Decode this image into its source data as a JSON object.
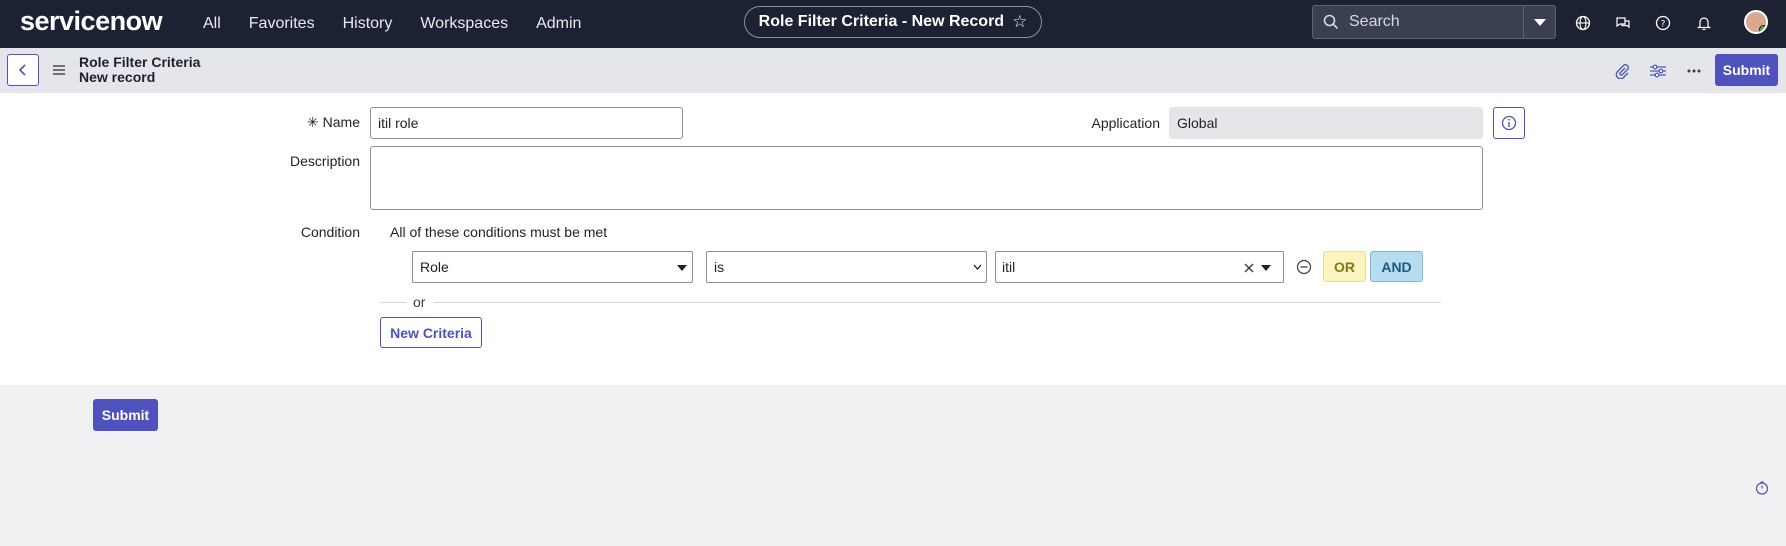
{
  "nav": {
    "logo": "servicenow",
    "items": [
      "All",
      "Favorites",
      "History",
      "Workspaces",
      "Admin"
    ],
    "record_title": "Role Filter Criteria - New Record",
    "search_placeholder": "Search"
  },
  "form_header": {
    "title": "Role Filter Criteria",
    "subtitle": "New record",
    "submit_label": "Submit"
  },
  "form": {
    "name_label": "Name",
    "name_value": "itil role",
    "application_label": "Application",
    "application_value": "Global",
    "description_label": "Description",
    "description_value": "",
    "condition_label": "Condition",
    "condition_heading": "All of these conditions must be met",
    "condition_row": {
      "field": "Role",
      "operator": "is",
      "value": "itil"
    },
    "or_label": "OR",
    "and_label": "AND",
    "or_separator": "or",
    "new_criteria_label": "New Criteria"
  },
  "footer": {
    "submit_label": "Submit"
  },
  "colors": {
    "nav_bg": "#1c2231",
    "primary": "#4f52bd",
    "or_bg": "#fbf3c0",
    "and_bg": "#b7dcef"
  }
}
